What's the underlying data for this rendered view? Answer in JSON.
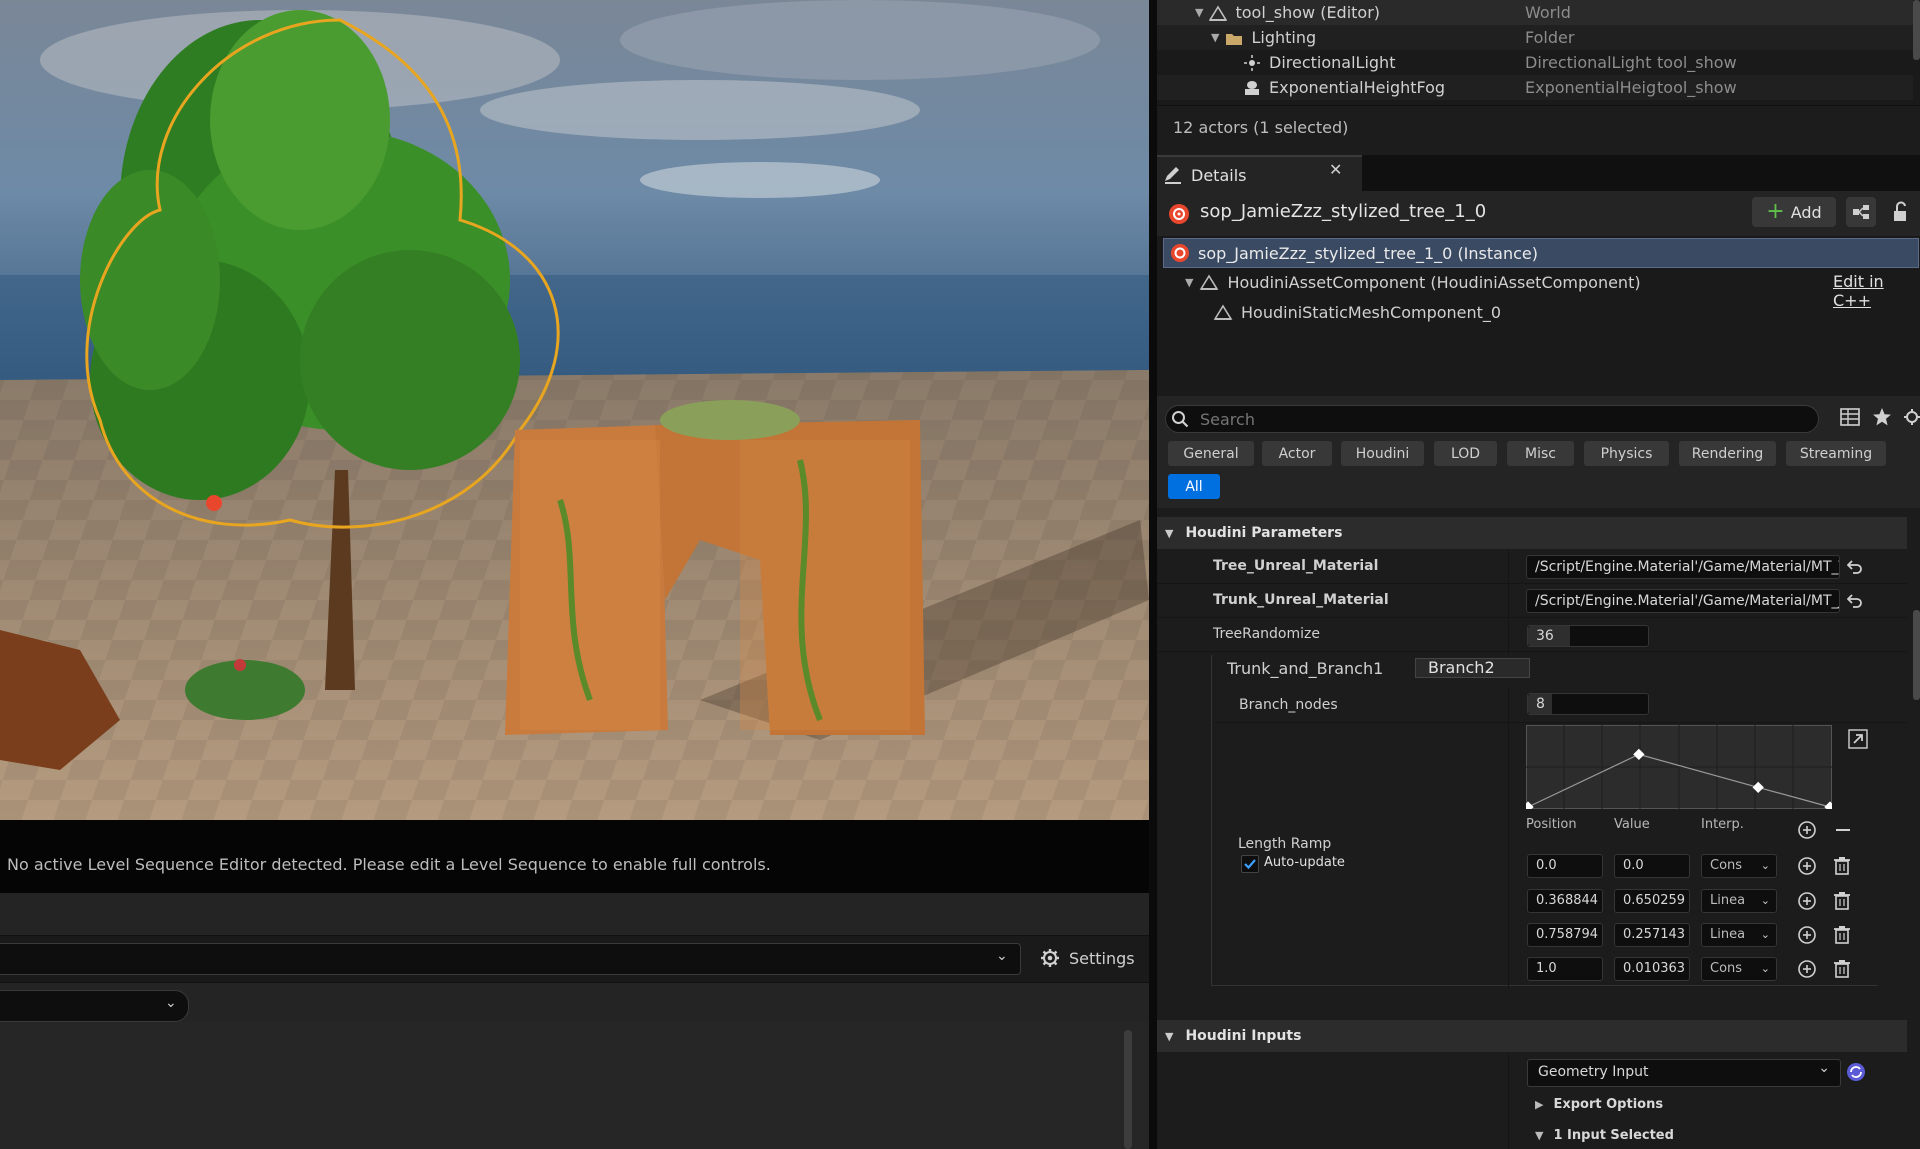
{
  "viewport": {
    "sequence_message": "No active Level Sequence Editor detected. Please edit a Level Sequence to enable full controls.",
    "settings_label": "Settings"
  },
  "outliner": {
    "rows": [
      {
        "name": "tool_show (Editor)",
        "type": "World",
        "extra": ""
      },
      {
        "name": "Lighting",
        "type": "Folder",
        "extra": ""
      },
      {
        "name": "DirectionalLight",
        "type": "DirectionalLight",
        "extra": "tool_show"
      },
      {
        "name": "ExponentialHeightFog",
        "type": "ExponentialHeig",
        "extra": "tool_show"
      }
    ],
    "actor_count": "12 actors (1 selected)"
  },
  "details": {
    "tab_label": "Details",
    "actor_name": "sop_JamieZzz_stylized_tree_1_0",
    "add_label": "Add",
    "components": [
      {
        "label": "sop_JamieZzz_stylized_tree_1_0 (Instance)"
      },
      {
        "label": "HoudiniAssetComponent (HoudiniAssetComponent)"
      },
      {
        "label": "HoudiniStaticMeshComponent_0"
      }
    ],
    "edit_cpp": "Edit in C++",
    "search_placeholder": "Search",
    "filters": [
      "General",
      "Actor",
      "Houdini",
      "LOD",
      "Misc",
      "Physics",
      "Rendering",
      "Streaming",
      "All"
    ],
    "active_filter": "All"
  },
  "houdini_parameters": {
    "category": "Houdini Parameters",
    "tree_material_label": "Tree_Unreal_Material",
    "tree_material_value": "/Script/Engine.Material'/Game/Material/MT_T",
    "trunk_material_label": "Trunk_Unreal_Material",
    "trunk_material_value": "/Script/Engine.Material'/Game/Material/MT_Ɲ",
    "tree_randomize_label": "TreeRandomize",
    "tree_randomize_value": "36",
    "tree_randomize_fraction": 0.35,
    "tabs": [
      "Trunk_and_Branch1",
      "Branch2"
    ],
    "branch_nodes_label": "Branch_nodes",
    "branch_nodes_value": "8",
    "branch_nodes_fraction": 0.2,
    "ramp_label": "Length Ramp",
    "auto_update_label": "Auto-update",
    "ramp_headers": [
      "Position",
      "Value",
      "Interp."
    ],
    "ramp_points": [
      {
        "position": "0.0",
        "value": "0.0",
        "interp": "Cons"
      },
      {
        "position": "0.368844",
        "value": "0.650259",
        "interp": "Linea"
      },
      {
        "position": "0.758794",
        "value": "0.257143",
        "interp": "Linea"
      },
      {
        "position": "1.0",
        "value": "0.010363",
        "interp": "Cons"
      }
    ]
  },
  "houdini_inputs": {
    "category": "Houdini Inputs",
    "input_type": "Geometry Input",
    "export_options": "Export Options",
    "input_selected": "1 Input Selected"
  }
}
